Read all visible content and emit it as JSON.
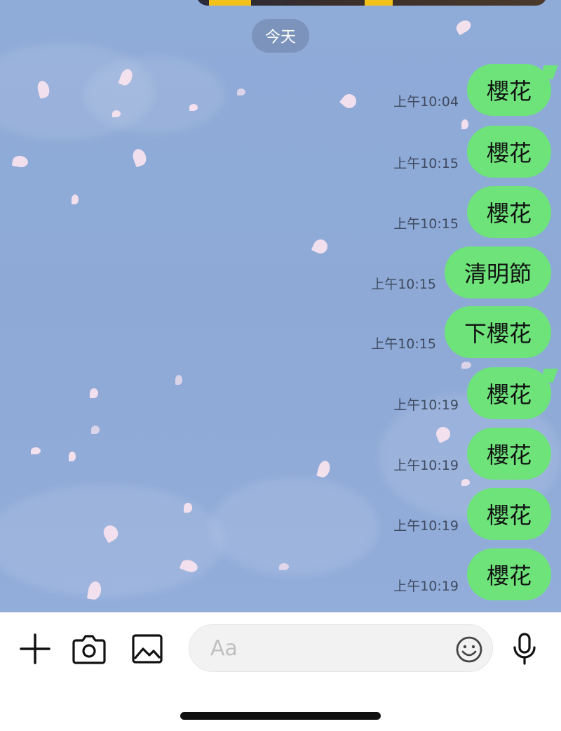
{
  "chat": {
    "date_label": "今天",
    "messages": [
      {
        "text": "櫻花",
        "time": "上午10:04"
      },
      {
        "text": "櫻花",
        "time": "上午10:15"
      },
      {
        "text": "櫻花",
        "time": "上午10:15"
      },
      {
        "text": "清明節",
        "time": "上午10:15"
      },
      {
        "text": "下櫻花",
        "time": "上午10:15"
      },
      {
        "text": "櫻花",
        "time": "上午10:19"
      },
      {
        "text": "櫻花",
        "time": "上午10:19"
      },
      {
        "text": "櫻花",
        "time": "上午10:19"
      },
      {
        "text": "櫻花",
        "time": "上午10:19"
      }
    ],
    "bubble_color": "#6de37a",
    "background_color": "#8fabd8"
  },
  "input_bar": {
    "placeholder": "Aa",
    "icons": [
      "plus-icon",
      "camera-icon",
      "image-icon",
      "emoji-icon",
      "microphone-icon"
    ]
  }
}
